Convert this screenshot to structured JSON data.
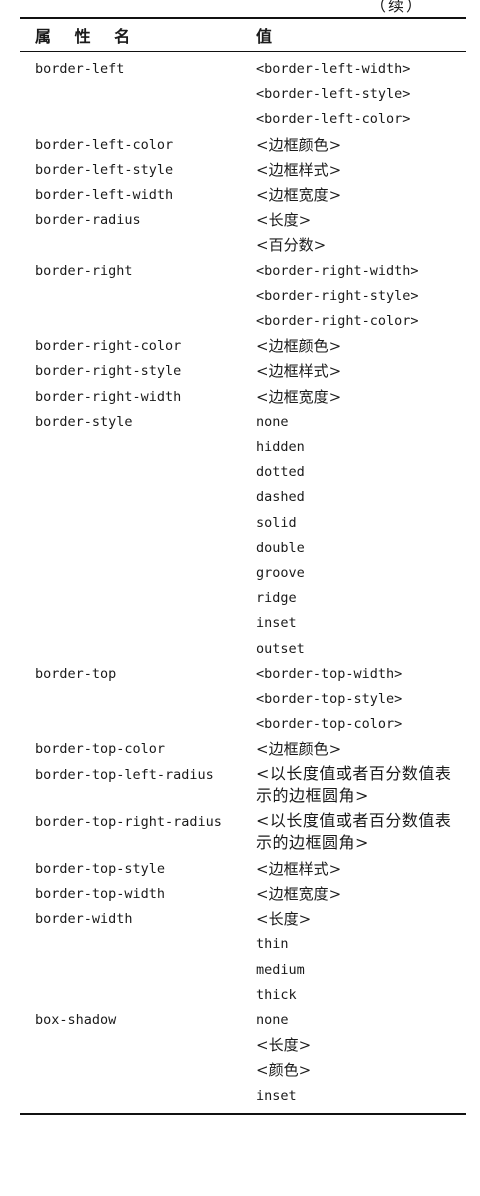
{
  "continued_label": "（续）",
  "table": {
    "headers": {
      "property": "属 性 名",
      "value": "值"
    },
    "rows": [
      {
        "property": "border-left",
        "values": [
          "<border-left-width>",
          "<border-left-style>",
          "<border-left-color>"
        ]
      },
      {
        "property": "border-left-color",
        "values": [
          "<边框颜色>"
        ]
      },
      {
        "property": "border-left-style",
        "values": [
          "<边框样式>"
        ]
      },
      {
        "property": "border-left-width",
        "values": [
          "<边框宽度>"
        ]
      },
      {
        "property": "border-radius",
        "values": [
          "<长度>",
          "<百分数>"
        ]
      },
      {
        "property": "border-right",
        "values": [
          "<border-right-width>",
          "<border-right-style>",
          "<border-right-color>"
        ]
      },
      {
        "property": "border-right-color",
        "values": [
          "<边框颜色>"
        ]
      },
      {
        "property": "border-right-style",
        "values": [
          "<边框样式>"
        ]
      },
      {
        "property": "border-right-width",
        "values": [
          "<边框宽度>"
        ]
      },
      {
        "property": "border-style",
        "values": [
          "none",
          "hidden",
          "dotted",
          "dashed",
          "solid",
          "double",
          "groove",
          "ridge",
          "inset",
          "outset"
        ]
      },
      {
        "property": "border-top",
        "values": [
          "<border-top-width>",
          "<border-top-style>",
          "<border-top-color>"
        ]
      },
      {
        "property": "border-top-color",
        "values": [
          "<边框颜色>"
        ]
      },
      {
        "property": "border-top-left-radius",
        "values": [
          "<以长度值或者百分数值表示的边框圆角>"
        ]
      },
      {
        "property": "border-top-right-radius",
        "values": [
          "<以长度值或者百分数值表示的边框圆角>"
        ]
      },
      {
        "property": "border-top-style",
        "values": [
          "<边框样式>"
        ]
      },
      {
        "property": "border-top-width",
        "values": [
          "<边框宽度>"
        ]
      },
      {
        "property": "border-width",
        "values": [
          "<长度>",
          "thin",
          "medium",
          "thick"
        ]
      },
      {
        "property": "box-shadow",
        "values": [
          "none",
          "<长度>",
          "<颜色>",
          "inset"
        ]
      }
    ]
  }
}
